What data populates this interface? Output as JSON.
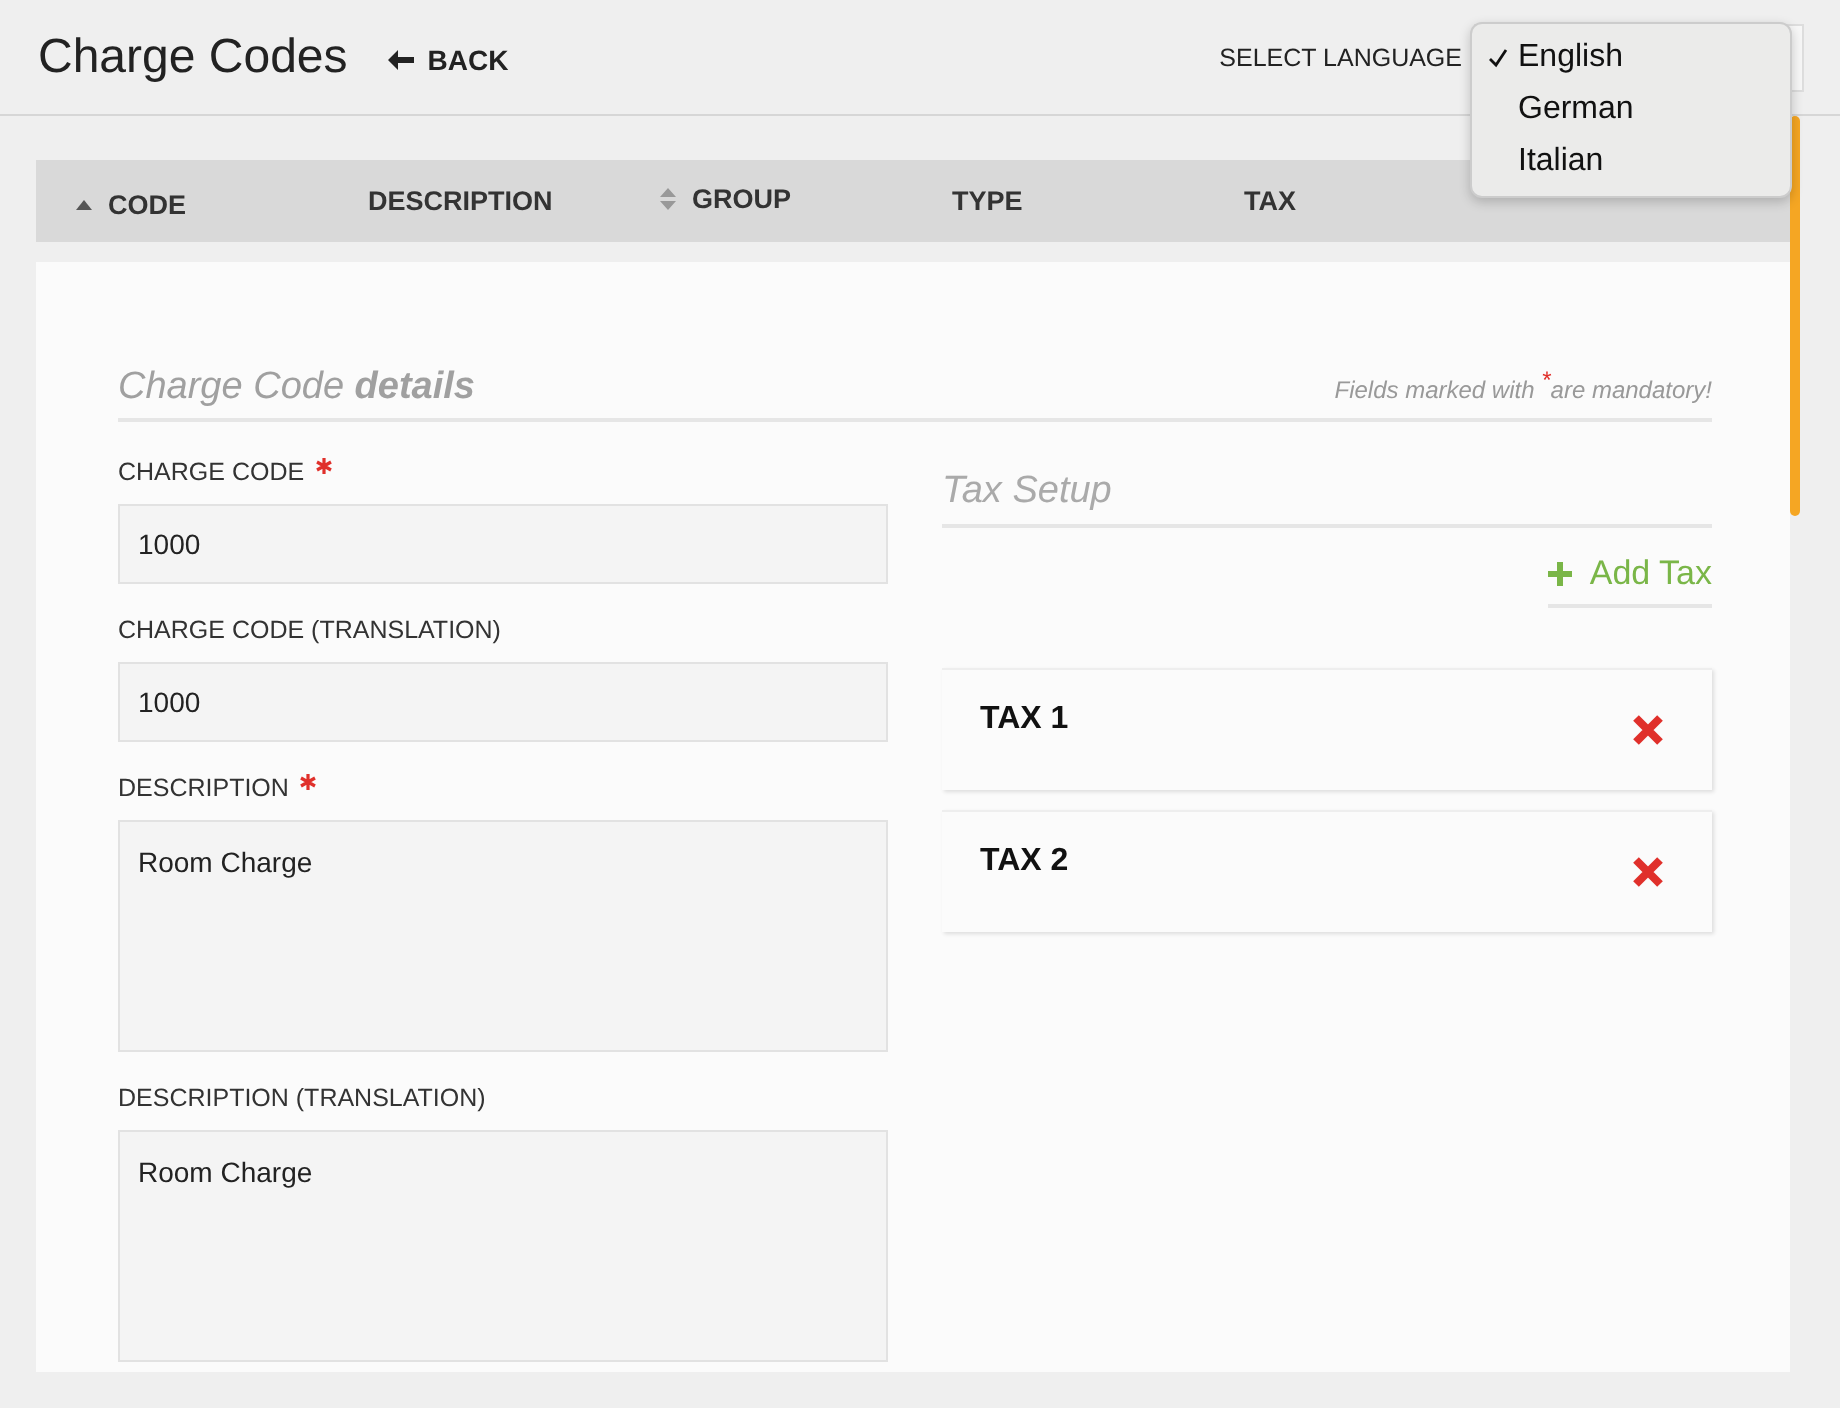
{
  "header": {
    "title": "Charge Codes",
    "back": "BACK",
    "language_label": "SELECT LANGUAGE",
    "language_options": [
      {
        "label": "English",
        "selected": true
      },
      {
        "label": "German",
        "selected": false
      },
      {
        "label": "Italian",
        "selected": false
      }
    ]
  },
  "table": {
    "columns": [
      {
        "label": "CODE",
        "kind": "sorted"
      },
      {
        "label": "DESCRIPTION",
        "kind": "plain"
      },
      {
        "label": "GROUP",
        "kind": "sortable"
      },
      {
        "label": "TYPE",
        "kind": "plain"
      },
      {
        "label": "TAX",
        "kind": "plain"
      }
    ]
  },
  "form": {
    "heading": "Charge Code **details**",
    "mandatory_note": "Fields marked with $^{*}$are mandatory!",
    "fields": [
      {
        "label": "CHARGE CODE",
        "required": true,
        "kind": "input",
        "value": "1000"
      },
      {
        "label": "CHARGE CODE (TRANSLATION)",
        "required": false,
        "kind": "input",
        "value": "1000"
      },
      {
        "label": "DESCRIPTION",
        "required": true,
        "kind": "textarea",
        "value": "Room Charge"
      },
      {
        "label": "DESCRIPTION (TRANSLATION)",
        "required": false,
        "kind": "textarea",
        "value": "Room Charge"
      }
    ]
  },
  "tax_setup": {
    "title": "Tax Setup",
    "add_label": "Add Tax",
    "taxes": [
      {
        "name": "TAX 1"
      },
      {
        "name": "TAX 2"
      }
    ]
  }
}
